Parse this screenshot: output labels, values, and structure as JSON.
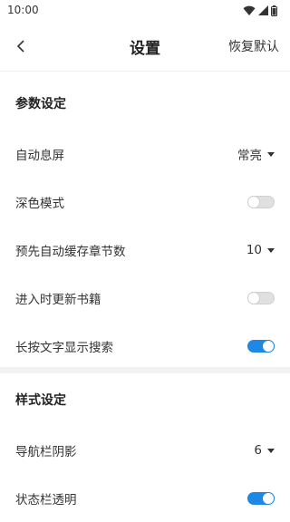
{
  "status_bar": {
    "time": "10:00",
    "icons": [
      "wifi-icon",
      "cellular-signal-icon",
      "battery-icon"
    ]
  },
  "app_bar": {
    "back_icon": "chevron-left-icon",
    "title": "设置",
    "reset_label": "恢复默认"
  },
  "colors": {
    "accent": "#1e88e5",
    "toggle_off": "#e0e0e0",
    "divider": "#f2f2f2"
  },
  "sections": [
    {
      "header": "参数设定",
      "rows": [
        {
          "label": "自动息屏",
          "type": "dropdown",
          "value": "常亮"
        },
        {
          "label": "深色模式",
          "type": "toggle",
          "checked": false
        },
        {
          "label": "预先自动缓存章节数",
          "type": "dropdown",
          "value": "10"
        },
        {
          "label": "进入时更新书籍",
          "type": "toggle",
          "checked": false
        },
        {
          "label": "长按文字显示搜索",
          "type": "toggle",
          "checked": true
        }
      ]
    },
    {
      "header": "样式设定",
      "rows": [
        {
          "label": "导航栏阴影",
          "type": "dropdown",
          "value": "6"
        },
        {
          "label": "状态栏透明",
          "type": "toggle",
          "checked": true
        }
      ]
    }
  ]
}
